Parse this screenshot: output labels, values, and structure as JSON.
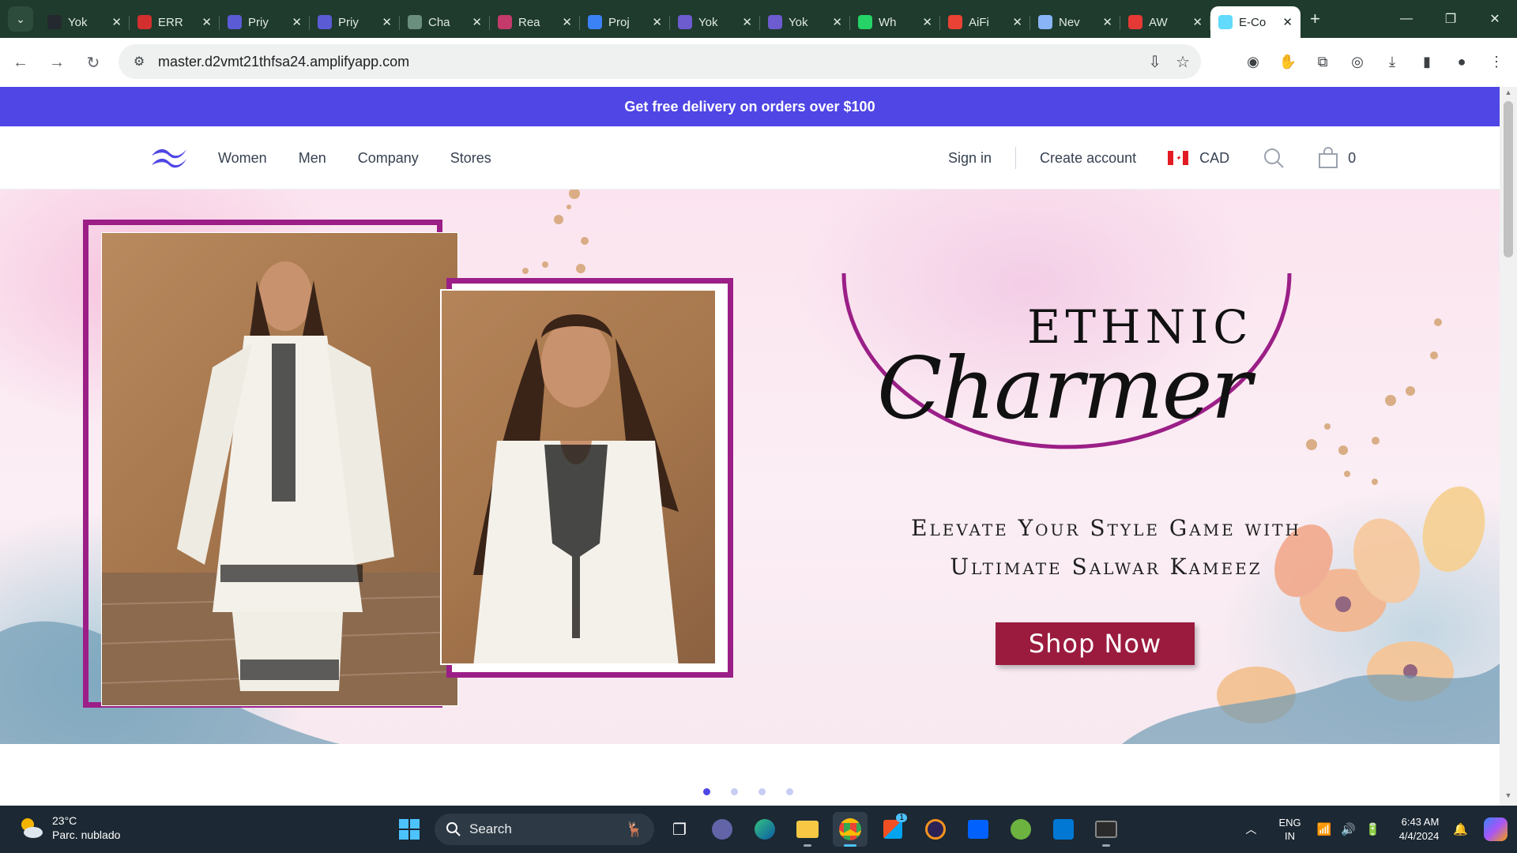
{
  "browser": {
    "tabs": [
      {
        "title": "Yok",
        "favicon": "github-icon",
        "color": "#24292f"
      },
      {
        "title": "ERR",
        "favicon": "error-page-icon",
        "color": "#d32f2f"
      },
      {
        "title": "Priy",
        "favicon": "brand-icon",
        "color": "#5b5bd6"
      },
      {
        "title": "Priy",
        "favicon": "brand-icon",
        "color": "#5b5bd6"
      },
      {
        "title": "Cha",
        "favicon": "chatgpt-icon",
        "color": "#6b8f7e"
      },
      {
        "title": "Rea",
        "favicon": "react-icon",
        "color": "#c43a6b"
      },
      {
        "title": "Proj",
        "favicon": "project-icon",
        "color": "#3b82f6"
      },
      {
        "title": "Yok",
        "favicon": "app-icon",
        "color": "#6d5bd0"
      },
      {
        "title": "Yok",
        "favicon": "app-icon",
        "color": "#6d5bd0"
      },
      {
        "title": "Wh",
        "favicon": "whatsapp-icon",
        "color": "#25d366"
      },
      {
        "title": "AiFi",
        "favicon": "google-icon",
        "color": "#ea4335"
      },
      {
        "title": "Nev",
        "favicon": "chrome-icon",
        "color": "#8ab4f8"
      },
      {
        "title": "AW",
        "favicon": "aws-amplify-icon",
        "color": "#e53935"
      },
      {
        "title": "E-Co",
        "favicon": "react-icon",
        "color": "#61dafb",
        "active": true
      }
    ],
    "url": "master.d2vmt21thfsa24.amplifyapp.com"
  },
  "site": {
    "promo": "Get free delivery on orders over $100",
    "nav": [
      "Women",
      "Men",
      "Company",
      "Stores"
    ],
    "sign_in": "Sign in",
    "create_account": "Create account",
    "currency": "CAD",
    "cart_count": "0",
    "brand_color": "#4f46e5"
  },
  "hero": {
    "brand_top": "ETHNIC",
    "brand_script": "Charmer",
    "tagline_line1": "Elevate Your Style Game with",
    "tagline_line2": "Ultimate Salwar Kameez",
    "cta": "Shop Now",
    "cta_color": "#9b1b3f",
    "frame_color": "#9b1f87",
    "slides": 4,
    "active_slide": 0
  },
  "taskbar": {
    "weather_temp": "23°C",
    "weather_desc": "Parc. nublado",
    "search_label": "Search",
    "lang": "ENG",
    "region": "IN",
    "time": "6:43 AM",
    "date": "4/4/2024",
    "store_badge": "1"
  }
}
